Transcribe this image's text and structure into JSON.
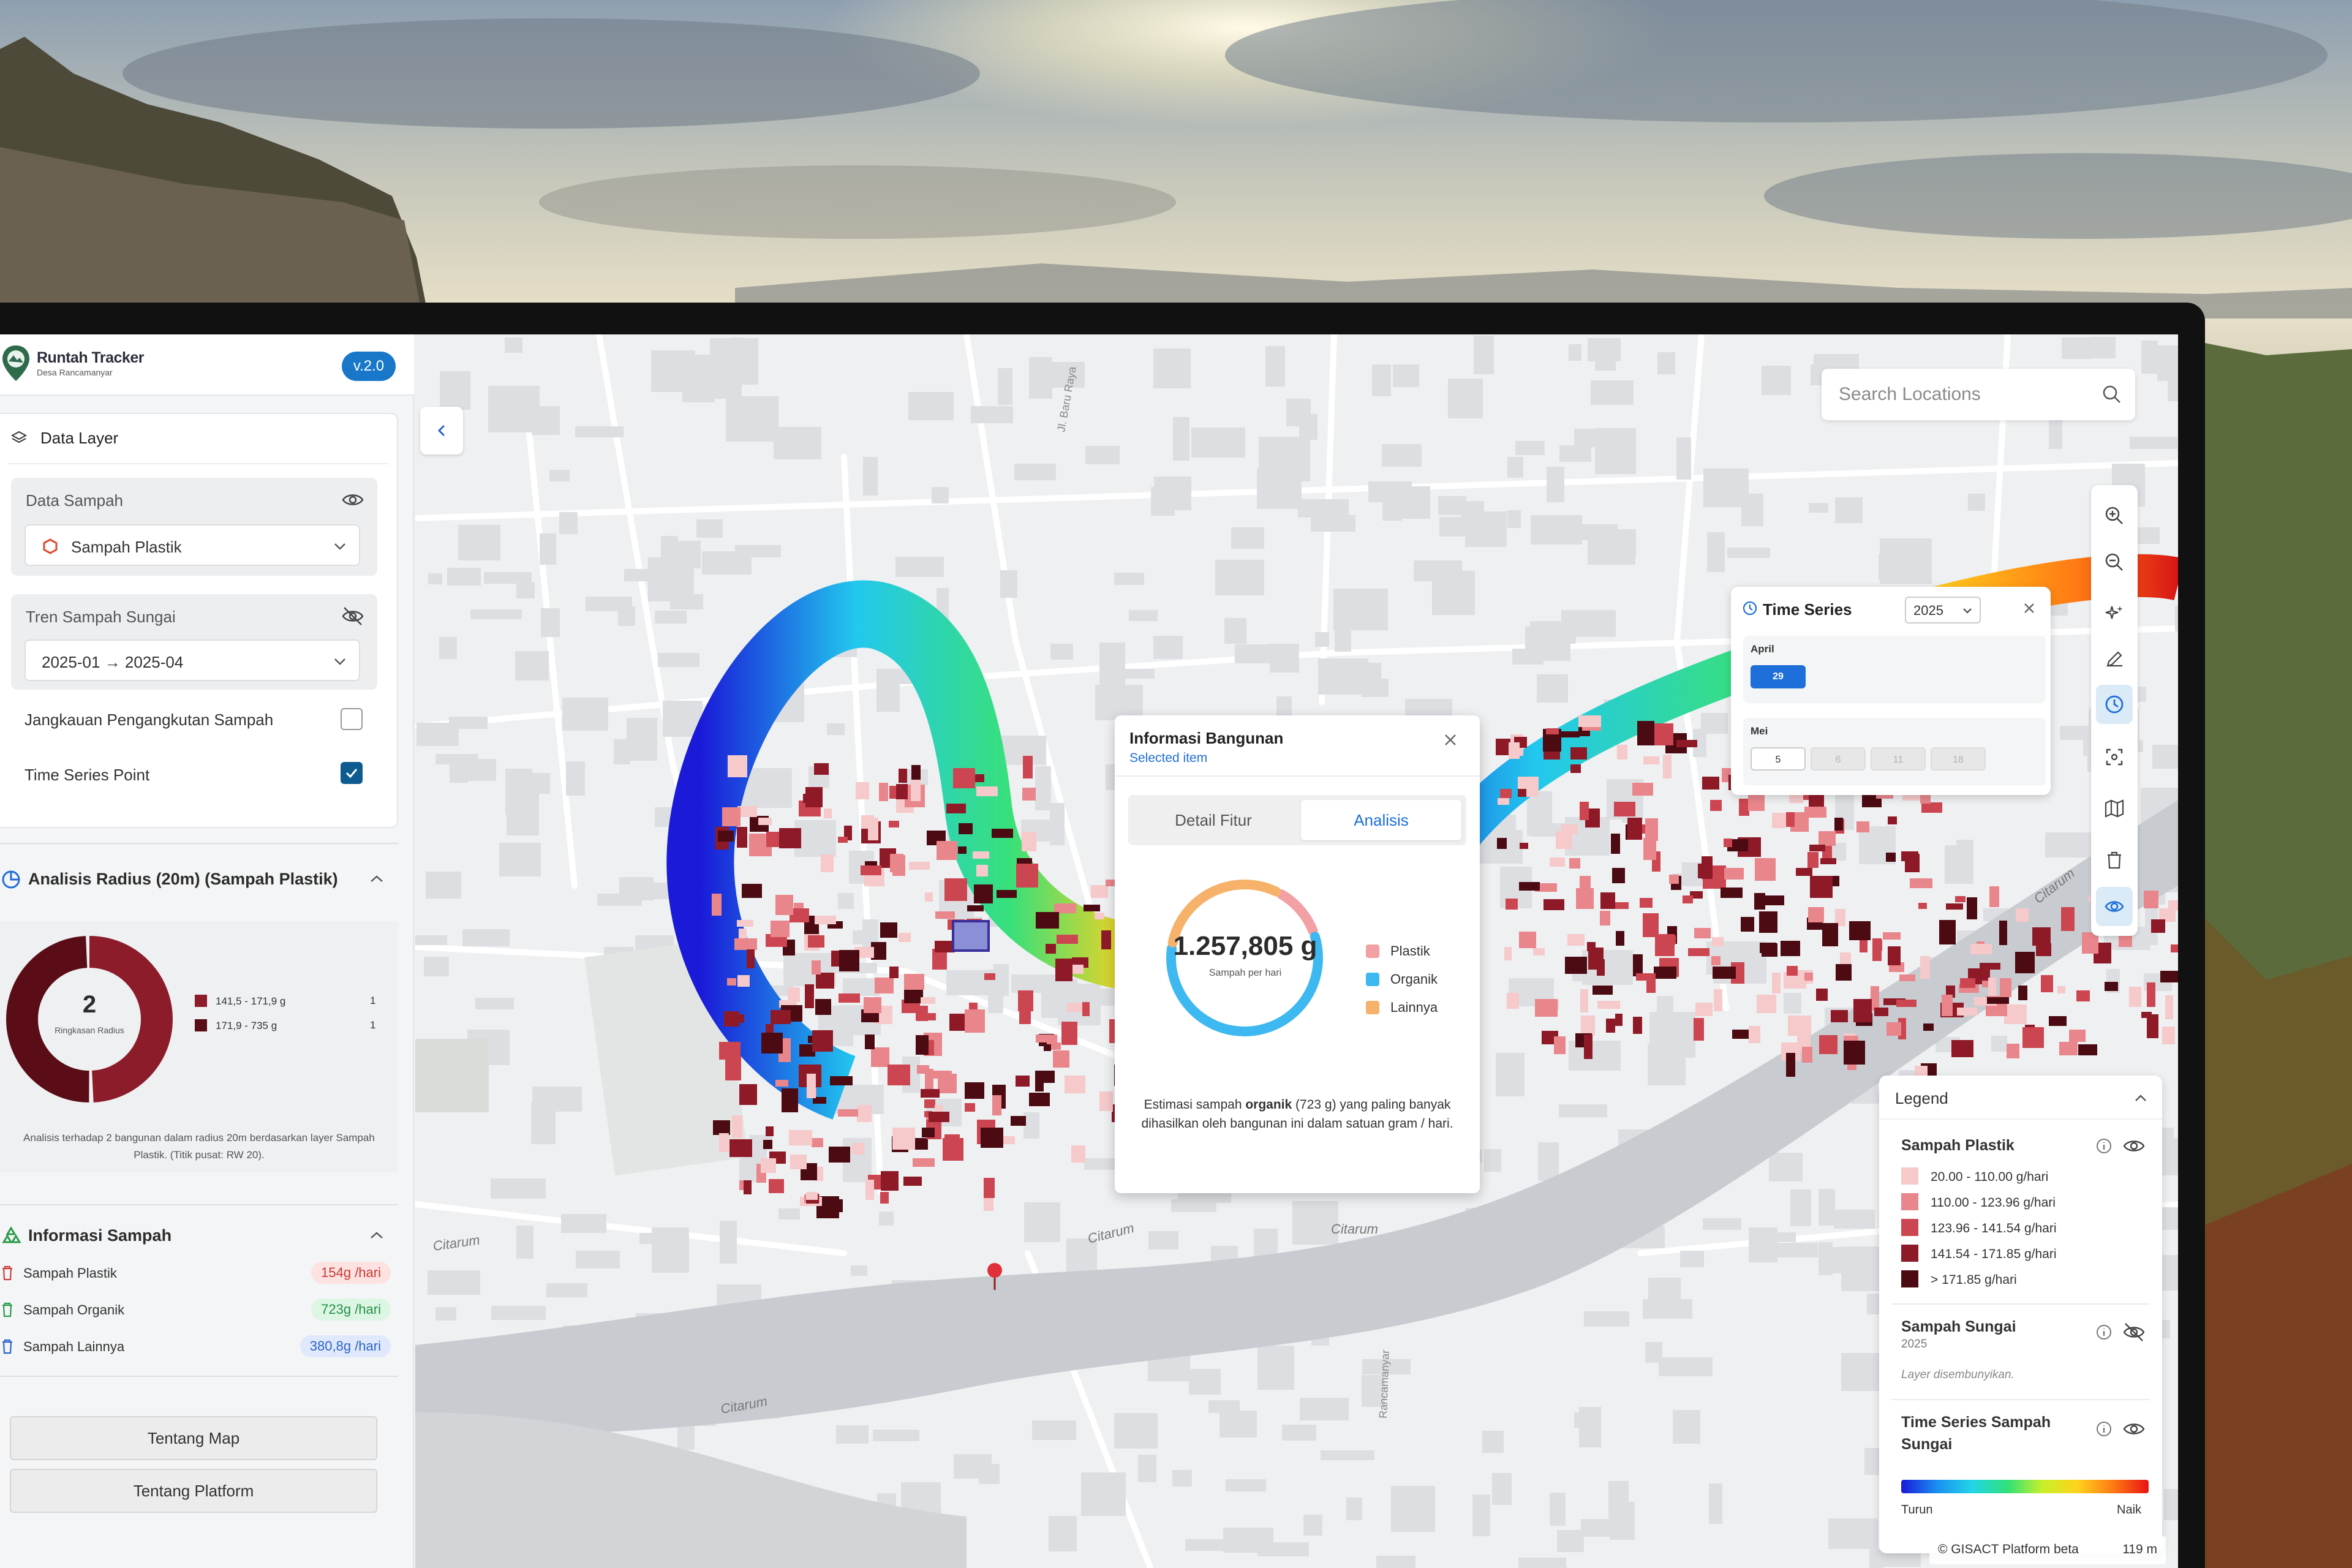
{
  "brand": {
    "name": "Runtah Tracker",
    "subtitle": "Desa Rancamanyar",
    "version": "v.2.0"
  },
  "data_layer": {
    "title": "Data Layer",
    "data_sampah": {
      "title": "Data Sampah",
      "selected": "Sampah Plastik",
      "visible": true
    },
    "tren_sungai": {
      "title": "Tren Sampah Sungai",
      "range_start": "2025-01",
      "range_arrow": "→",
      "range_end": "2025-04",
      "visible": false
    },
    "options": [
      {
        "label": "Jangkauan Pengangkutan Sampah",
        "checked": false
      },
      {
        "label": "Time Series Point",
        "checked": true
      }
    ]
  },
  "radius_analysis": {
    "title": "Analisis Radius (20m) (Sampah Plastik)",
    "center_value": "2",
    "center_label": "Ringkasan Radius",
    "items": [
      {
        "label": "141,5 - 171,9 g",
        "count": "1",
        "color": "#8c1c2a"
      },
      {
        "label": "171,9 - 735 g",
        "count": "1",
        "color": "#5a0d16"
      }
    ],
    "note": "Analisis terhadap 2 bangunan dalam radius 20m berdasarkan layer Sampah Plastik. (Titik pusat: RW 20)."
  },
  "info_sampah": {
    "title": "Informasi Sampah",
    "rows": [
      {
        "label": "Sampah Plastik",
        "value": "154g /hari",
        "tone": "red"
      },
      {
        "label": "Sampah Organik",
        "value": "723g /hari",
        "tone": "green"
      },
      {
        "label": "Sampah Lainnya",
        "value": "380,8g /hari",
        "tone": "blue"
      }
    ]
  },
  "buttons": {
    "about_map": "Tentang Map",
    "about_platform": "Tentang Platform"
  },
  "search": {
    "placeholder": "Search Locations"
  },
  "time_series": {
    "title": "Time Series",
    "year": "2025",
    "months": [
      {
        "name": "April",
        "days": [
          {
            "label": "29",
            "state": "selected"
          }
        ]
      },
      {
        "name": "Mei",
        "days": [
          {
            "label": "5",
            "state": "available"
          },
          {
            "label": "6",
            "state": "disabled"
          },
          {
            "label": "11",
            "state": "disabled"
          },
          {
            "label": "18",
            "state": "disabled"
          }
        ]
      }
    ]
  },
  "popup": {
    "title": "Informasi Bangunan",
    "subtitle": "Selected item",
    "tabs": [
      "Detail Fitur",
      "Analisis"
    ],
    "active_tab": "Analisis",
    "total": "1.257,805 g",
    "total_label": "Sampah per hari",
    "legend": [
      {
        "label": "Plastik",
        "color": "#f2a0a3"
      },
      {
        "label": "Organik",
        "color": "#3db8f0"
      },
      {
        "label": "Lainnya",
        "color": "#f6b26b"
      }
    ],
    "share_approx": {
      "Plastik": 0.12,
      "Organik": 0.58,
      "Lainnya": 0.3
    },
    "note_prefix": "Estimasi sampah ",
    "note_bold": "organik",
    "note_suffix": " (723 g) yang paling banyak dihasilkan oleh bangunan ini dalam satuan gram / hari."
  },
  "legend": {
    "title": "Legend",
    "plastik": {
      "title": "Sampah Plastik",
      "classes": [
        {
          "label": "20.00 - 110.00 g/hari",
          "color": "#f6c9cb"
        },
        {
          "label": "110.00 - 123.96 g/hari",
          "color": "#e8868c"
        },
        {
          "label": "123.96 - 141.54 g/hari",
          "color": "#cc4651"
        },
        {
          "label": "141.54 - 171.85 g/hari",
          "color": "#8e1a28"
        },
        {
          "label": "> 171.85 g/hari",
          "color": "#4c0a12"
        }
      ]
    },
    "sungai": {
      "title": "Sampah Sungai",
      "year": "2025",
      "hidden_text": "Layer disembunyikan."
    },
    "time_series": {
      "title_line1": "Time Series Sampah",
      "title_line2": "Sungai",
      "low": "Turun",
      "high": "Naik"
    }
  },
  "map_labels": {
    "citarum_1": "Citarum",
    "citarum_2": "Citarum",
    "citarum_3": "Citarum",
    "citarum_4": "Citarum",
    "citarum_5": "Citarum",
    "jl_baru_raya": "Jl. Baru Raya",
    "rancamanyar": "Rancamanyar"
  },
  "attribution": {
    "text": "© GISACT Platform beta",
    "scale": "119 m"
  }
}
